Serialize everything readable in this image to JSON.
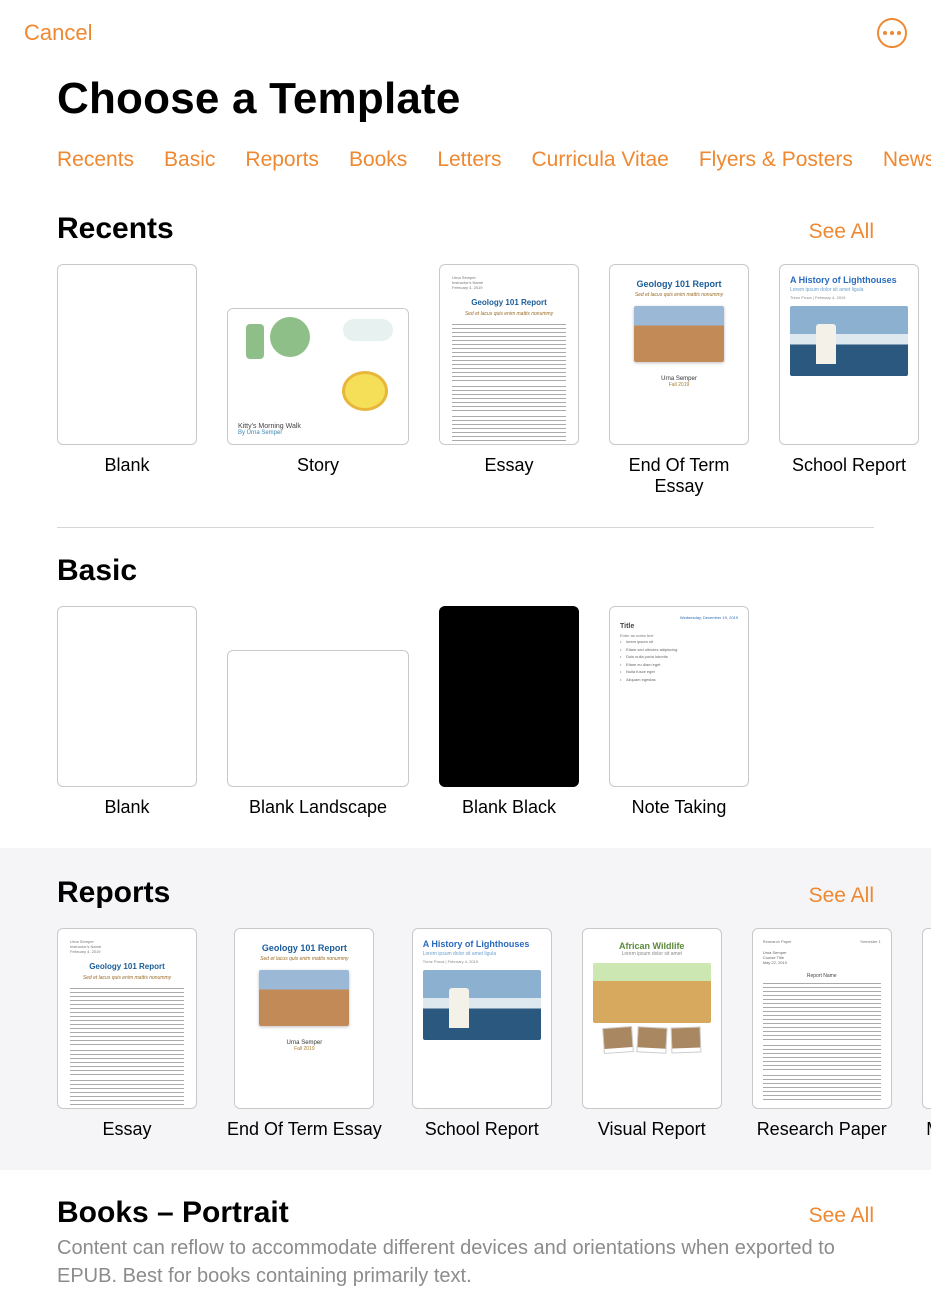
{
  "header": {
    "cancel": "Cancel",
    "title": "Choose a Template"
  },
  "tabs": [
    "Recents",
    "Basic",
    "Reports",
    "Books",
    "Letters",
    "Curricula Vitae",
    "Flyers & Posters",
    "Newsletters"
  ],
  "see_all": "See All",
  "sections": {
    "recents": {
      "title": "Recents",
      "items": [
        {
          "label": "Blank"
        },
        {
          "label": "Story",
          "story_title": "Kitty's Morning Walk",
          "story_author": "By Urna Semper"
        },
        {
          "label": "Essay",
          "doc_title": "Geology 101 Report",
          "doc_sub": "Sed et lacus quis enim mattis nonummy",
          "author": "Urna Semper",
          "date": "February 4, 2019"
        },
        {
          "label": "End Of Term Essay",
          "doc_title": "Geology 101 Report",
          "doc_sub": "Sed et lacus quis enim mattis nonummy",
          "author": "Urna Semper",
          "year": "Fall 2019"
        },
        {
          "label": "School Report",
          "doc_title": "A History of Lighthouses",
          "doc_sub": "Lorem ipsum dolor sit amet ligula",
          "meta": "Trenz Pruca | February 4, 2019"
        }
      ]
    },
    "basic": {
      "title": "Basic",
      "items": [
        {
          "label": "Blank"
        },
        {
          "label": "Blank Landscape"
        },
        {
          "label": "Blank Black"
        },
        {
          "label": "Note Taking",
          "date": "Wednesday, December 19, 2019",
          "title_text": "Title",
          "sub": "Enter as notes text"
        }
      ]
    },
    "reports": {
      "title": "Reports",
      "items": [
        {
          "label": "Essay",
          "doc_title": "Geology 101 Report",
          "doc_sub": "Sed et lacus quis enim mattis nonummy",
          "author": "Urna Semper",
          "date": "February 4, 2019"
        },
        {
          "label": "End Of Term Essay",
          "doc_title": "Geology 101 Report",
          "doc_sub": "Sed et lacus quis enim mattis nonummy",
          "author": "Urna Semper",
          "year": "Fall 2019"
        },
        {
          "label": "School Report",
          "doc_title": "A History of Lighthouses",
          "doc_sub": "Lorem ipsum dolor sit amet ligula",
          "meta": "Trenz Pruca | February 4, 2019"
        },
        {
          "label": "Visual Report",
          "doc_title": "African Wildlife",
          "doc_sub": "Lorem ipsum dolor sit amet"
        },
        {
          "label": "Research Paper",
          "doc_title": "Research Paper",
          "author": "Urna Semper",
          "date": "May 22, 2019",
          "semester": "Semester 1",
          "heading": "Report Name"
        },
        {
          "label": "M"
        }
      ]
    },
    "books": {
      "title": "Books – Portrait",
      "subtitle": "Content can reflow to accommodate different devices and orientations when exported to EPUB. Best for books containing primarily text."
    }
  }
}
